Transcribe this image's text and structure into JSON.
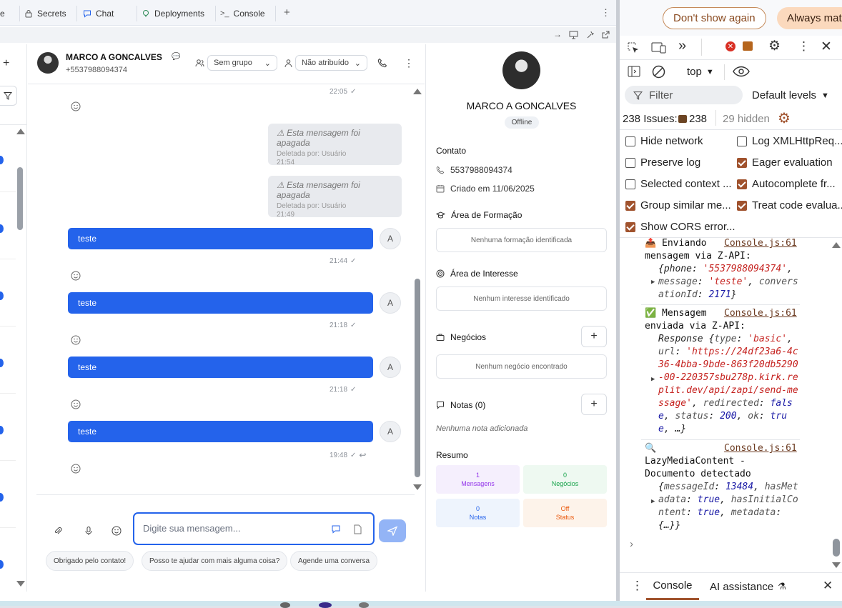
{
  "browser": {
    "tabs": [
      "e",
      "Secrets",
      "Chat",
      "Deployments",
      "Console"
    ],
    "new_tab": "+"
  },
  "chat": {
    "contact_name": "MARCO A GONCALVES",
    "contact_phone": "+5537988094374",
    "group_select": "Sem grupo",
    "assign_select": "Não atribuído",
    "top_time": "22:05",
    "deleted_messages": [
      {
        "text": "Esta mensagem foi apagada",
        "by": "Deletada por: Usuário",
        "time": "21:54"
      },
      {
        "text": "Esta mensagem foi apagada",
        "by": "Deletada por: Usuário",
        "time": "21:49"
      }
    ],
    "messages": [
      {
        "text": "teste",
        "avatar": "A",
        "time": "21:44"
      },
      {
        "text": "teste",
        "avatar": "A",
        "time": "21:18"
      },
      {
        "text": "teste",
        "avatar": "A",
        "time": "21:18"
      },
      {
        "text": "teste",
        "avatar": "A",
        "time": "19:48"
      }
    ],
    "input_placeholder": "Digite sua mensagem...",
    "quick_replies": [
      "Obrigado pelo contato!",
      "Posso te ajudar com mais alguma coisa?",
      "Agende uma conversa"
    ]
  },
  "info": {
    "name": "MARCO A GONCALVES",
    "status": "Offline",
    "contact_title": "Contato",
    "phone": "5537988094374",
    "created": "Criado em 11/06/2025",
    "formacao_title": "Área de Formação",
    "formacao_empty": "Nenhuma formação identificada",
    "interesse_title": "Área de Interesse",
    "interesse_empty": "Nenhum interesse identificado",
    "negocios_title": "Negócios",
    "negocios_empty": "Nenhum negócio encontrado",
    "notas_title": "Notas (0)",
    "notas_empty": "Nenhuma nota adicionada",
    "resumo_title": "Resumo",
    "stats": [
      {
        "value": "1",
        "label": "Mensagens",
        "color": "#9333ea",
        "bg": "#f5effd"
      },
      {
        "value": "0",
        "label": "Negócios",
        "color": "#16a34a",
        "bg": "#eef9f1"
      },
      {
        "value": "0",
        "label": "Notas",
        "color": "#2563eb",
        "bg": "#eef4fd"
      },
      {
        "value": "Off",
        "label": "Status",
        "color": "#ea580c",
        "bg": "#fdf3ea"
      }
    ]
  },
  "devtools": {
    "dont_show": "Don't show again",
    "always_match": "Always mat",
    "context": "top",
    "filter_placeholder": "Filter",
    "levels": "Default levels",
    "issues_label": "238 Issues:",
    "issues_count": "238",
    "hidden": "29 hidden",
    "settings": [
      {
        "label": "Hide network",
        "checked": false
      },
      {
        "label": "Log XMLHttpReq...",
        "checked": false
      },
      {
        "label": "Preserve log",
        "checked": false
      },
      {
        "label": "Eager evaluation",
        "checked": true
      },
      {
        "label": "Selected context ...",
        "checked": false
      },
      {
        "label": "Autocomplete fr...",
        "checked": true
      },
      {
        "label": "Group similar me...",
        "checked": true
      },
      {
        "label": "Treat code evalua...",
        "checked": true
      },
      {
        "label": "Show CORS error...",
        "checked": true
      }
    ],
    "logs": [
      {
        "icon": "📤",
        "lead": "Enviando",
        "rest": "mensagem via Z-API:",
        "source": "Console.js:61"
      },
      {
        "icon": "✅",
        "lead": "Mensagem",
        "rest": "enviada via Z-API:",
        "source": "Console.js:61"
      },
      {
        "icon": "🔍",
        "lead": "",
        "rest": "LazyMediaContent - Documento detectado",
        "source": "Console.js:61"
      }
    ],
    "bottom_tabs": [
      "Console",
      "AI assistance"
    ]
  },
  "colors": {
    "primary": "#2463eb",
    "devtools_accent": "#a0522d"
  }
}
